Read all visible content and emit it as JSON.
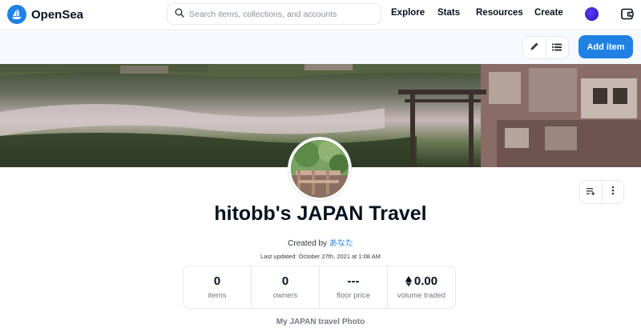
{
  "nav": {
    "brand": "OpenSea",
    "search_placeholder": "Search items, collections, and accounts",
    "links": [
      "Explore",
      "Stats",
      "Resources",
      "Create"
    ]
  },
  "toolbar": {
    "add_item_label": "Add item"
  },
  "collection": {
    "title": "hitobb's JAPAN Travel",
    "created_by_prefix": "Created by",
    "creator": "あなた",
    "last_updated": "Last updated: October 27th, 2021 at 1:08 AM",
    "description": "My JAPAN travel Photo"
  },
  "stats": [
    {
      "value": "0",
      "label": "items"
    },
    {
      "value": "0",
      "label": "owners"
    },
    {
      "value": "---",
      "label": "floor price"
    },
    {
      "value": "0.00",
      "label": "volume traded"
    }
  ],
  "colors": {
    "accent": "#2081e2",
    "text": "#04111d",
    "muted": "#707a83"
  },
  "icons": [
    "opensea-logo-icon",
    "search-icon",
    "avatar",
    "wallet-icon",
    "pencil-icon",
    "list-icon",
    "filter-icon",
    "more-vertical-icon",
    "ethereum-icon"
  ]
}
